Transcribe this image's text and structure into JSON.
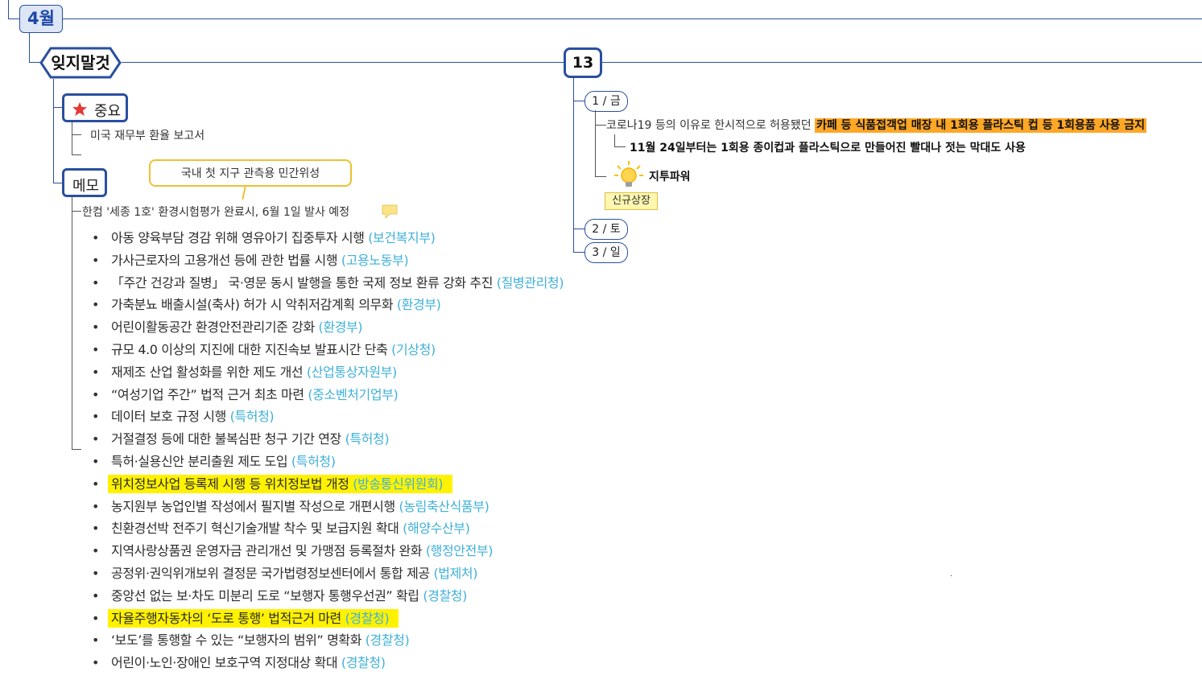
{
  "root": {
    "month_label": "4월"
  },
  "left_branch": {
    "title": "잊지말것",
    "important": {
      "label": "중요",
      "items": [
        "미국 재무부 환율 보고서",
        ""
      ]
    },
    "memo": {
      "label": "메모",
      "callout": "국내 첫 지구 관측용 민간위성",
      "note_line": "한컴 '세종 1호'  환경시험평가  완료시, 6월 1일 발사 예정",
      "list": [
        {
          "text": "아동 양육부담 경감 위해 영유아기 집중투자 시행 ",
          "agency": "(보건복지부)",
          "highlight": false
        },
        {
          "text": "가사근로자의 고용개선 등에 관한 법률 시행 ",
          "agency": "(고용노동부)",
          "highlight": false
        },
        {
          "text": "「주간 건강과 질병」 국·영문 동시 발행을 통한 국제 정보 환류 강화 추진 ",
          "agency": "(질병관리청)",
          "highlight": false
        },
        {
          "text": "가축분뇨 배출시설(축사) 허가 시 악취저감계획 의무화 ",
          "agency": "(환경부)",
          "highlight": false
        },
        {
          "text": "어린이활동공간 환경안전관리기준 강화 ",
          "agency": "(환경부)",
          "highlight": false
        },
        {
          "text": "규모 4.0 이상의 지진에 대한 지진속보 발표시간 단축 ",
          "agency": "(기상청)",
          "highlight": false
        },
        {
          "text": "재제조 산업 활성화를 위한 제도 개선 ",
          "agency": "(산업통상자원부)",
          "highlight": false
        },
        {
          "text": "“여성기업 주간” 법적 근거 최초 마련 ",
          "agency": "(중소벤처기업부)",
          "highlight": false
        },
        {
          "text": "데이터 보호 규정 시행 ",
          "agency": "(특허청)",
          "highlight": false
        },
        {
          "text": "거절결정 등에 대한 불복심판 청구 기간 연장 ",
          "agency": "(특허청)",
          "highlight": false
        },
        {
          "text": "특허·실용신안 분리출원 제도 도입 ",
          "agency": "(특허청)",
          "highlight": false
        },
        {
          "text": "위치정보사업 등록제 시행 등 위치정보법 개정 ",
          "agency": "(방송통신위원회)",
          "highlight": true
        },
        {
          "text": "농지원부 농업인별 작성에서 필지별 작성으로 개편시행 ",
          "agency": "(농림축산식품부)",
          "highlight": false
        },
        {
          "text": "친환경선박 전주기 혁신기술개발 착수 및 보급지원 확대 ",
          "agency": "(해양수산부)",
          "highlight": false
        },
        {
          "text": "지역사랑상품권 운영자금 관리개선 및 가맹점 등록절차 완화 ",
          "agency": "(행정안전부)",
          "highlight": false
        },
        {
          "text": "공정위·권익위개보위 결정문 국가법령정보센터에서 통합 제공 ",
          "agency": "(법제처)",
          "highlight": false
        },
        {
          "text": "중앙선 없는 보·차도 미분리 도로 “보행자 통행우선권” 확립 ",
          "agency": "(경찰청)",
          "highlight": false
        },
        {
          "text": "자율주행자동차의 ‘도로 통행’ 법적근거 마련 ",
          "agency": "(경찰청)",
          "highlight": true
        },
        {
          "text": "‘보도’를 통행할 수 있는 “보행자의 범위” 명확화 ",
          "agency": "(경찰청)",
          "highlight": false
        },
        {
          "text": "어린이·노인·장애인 보호구역 지정대상 확대 ",
          "agency": "(경찰청)",
          "highlight": false
        }
      ]
    }
  },
  "right_branch": {
    "title": "13",
    "days": [
      {
        "label": "1 / 금"
      },
      {
        "label": "2 / 토"
      },
      {
        "label": "3 / 일"
      }
    ],
    "day1": {
      "line1_prefix": "코로나19 등의 이유로 한시적으로 허용됐던 ",
      "line1_highlight": "카페 등 식품접객업 매장 내 1회용 플라스틱 컵 등 1회용품 사용 금지",
      "line2": "11월 24일부터는 1회용 종이컵과 플라스틱으로 만들어진 빨대나 젓는 막대도 사용",
      "idea_label": "지투파워",
      "idea_badge": "신규상장"
    }
  },
  "icons": {
    "important": "star-icon",
    "idea": "lightbulb-icon",
    "note": "note-icon"
  },
  "colors": {
    "branch_line": "#2a4fa0",
    "highlight_yellow": "#fff200",
    "highlight_orange": "#ffa726",
    "agency_text": "#3fb0d8"
  }
}
